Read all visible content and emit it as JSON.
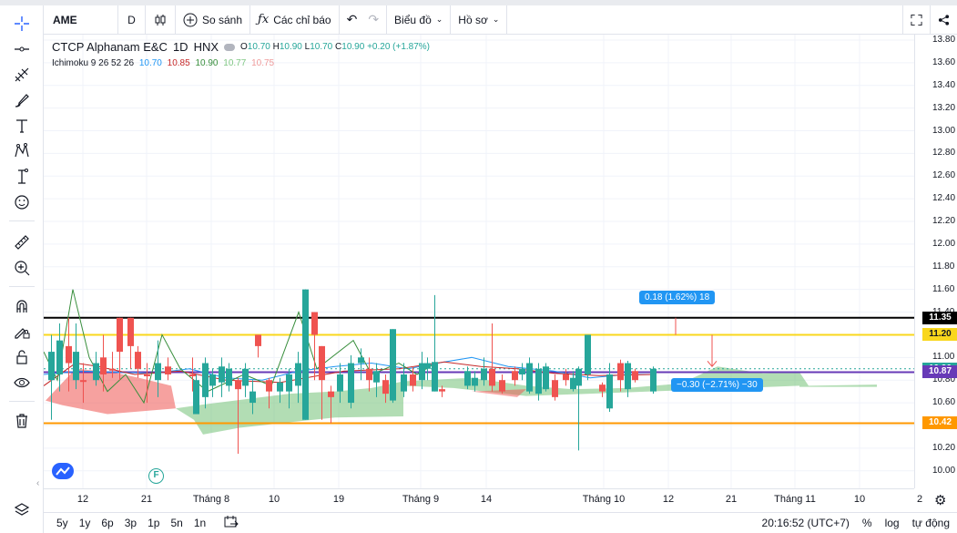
{
  "toolbar": {
    "symbol": "AME",
    "interval": "D",
    "compare_label": "So sánh",
    "indicators_label": "Các chỉ báo",
    "chart_label": "Biểu đồ",
    "profile_label": "Hồ sơ"
  },
  "legend": {
    "name": "CTCP Alphanam E&C",
    "interval": "1D",
    "exchange": "HNX",
    "o_label": "O",
    "o": "10.70",
    "h_label": "H",
    "h": "10.90",
    "l_label": "L",
    "l": "10.70",
    "c_label": "C",
    "c": "10.90",
    "change": "+0.20 (+1.87%)",
    "indicator": "Ichimoku 9 26 52 26",
    "ind_values": [
      {
        "text": "10.70",
        "color": "#2196f3"
      },
      {
        "text": "10.85",
        "color": "#c62828"
      },
      {
        "text": "10.90",
        "color": "#388e3c"
      },
      {
        "text": "10.77",
        "color": "#81c784"
      },
      {
        "text": "10.75",
        "color": "#ef9a9a"
      }
    ]
  },
  "price_axis": {
    "ticks": [
      "13.80",
      "13.60",
      "13.40",
      "13.20",
      "13.00",
      "12.80",
      "12.60",
      "12.40",
      "12.20",
      "12.00",
      "11.80",
      "11.60",
      "11.40",
      "11.20",
      "11.00",
      "10.80",
      "10.60",
      "10.40",
      "10.20",
      "10.00"
    ],
    "badges": [
      {
        "text": "11.35",
        "value": 11.35,
        "color": "#000000"
      },
      {
        "text": "11.20",
        "value": 11.2,
        "color": "#f9d71c"
      },
      {
        "text": "10.90",
        "value": 10.9,
        "color": "#26a69a"
      },
      {
        "text": "10.87",
        "value": 10.87,
        "color": "#673ab7"
      },
      {
        "text": "10.42",
        "value": 10.42,
        "color": "#ff9800"
      }
    ]
  },
  "time_axis": {
    "ticks": [
      {
        "text": "12"
      },
      {
        "text": "21"
      },
      {
        "text": "Tháng 8"
      },
      {
        "text": "10"
      },
      {
        "text": "19"
      },
      {
        "text": "Tháng 9"
      },
      {
        "text": "14"
      },
      {
        "text": "Tháng 10"
      },
      {
        "text": "12"
      },
      {
        "text": "21"
      },
      {
        "text": "Tháng 11"
      },
      {
        "text": "10"
      },
      {
        "text": "2"
      }
    ]
  },
  "measures": [
    {
      "text": "0.18 (1.62%) 18"
    },
    {
      "text": "−0.30 (−2.71%) −30"
    }
  ],
  "badge_f": "F",
  "bottom": {
    "ranges": [
      "5y",
      "1y",
      "6p",
      "3p",
      "1p",
      "5n",
      "1n"
    ],
    "time": "20:16:52 (UTC+7)",
    "percent": "%",
    "log": "log",
    "auto": "tự động"
  },
  "colors": {
    "up": "#26a69a",
    "down": "#ef5350",
    "accent": "#2196f3"
  },
  "icons": [
    "crosshair-icon",
    "line-icon",
    "fib-icon",
    "brush-icon",
    "text-icon",
    "pattern-icon",
    "measure-icon",
    "emoji-icon",
    "ruler-icon",
    "zoom-icon",
    "magnet-icon",
    "lock-draw-icon",
    "lock-icon",
    "eye-icon",
    "trash-icon",
    "layers-icon"
  ]
}
